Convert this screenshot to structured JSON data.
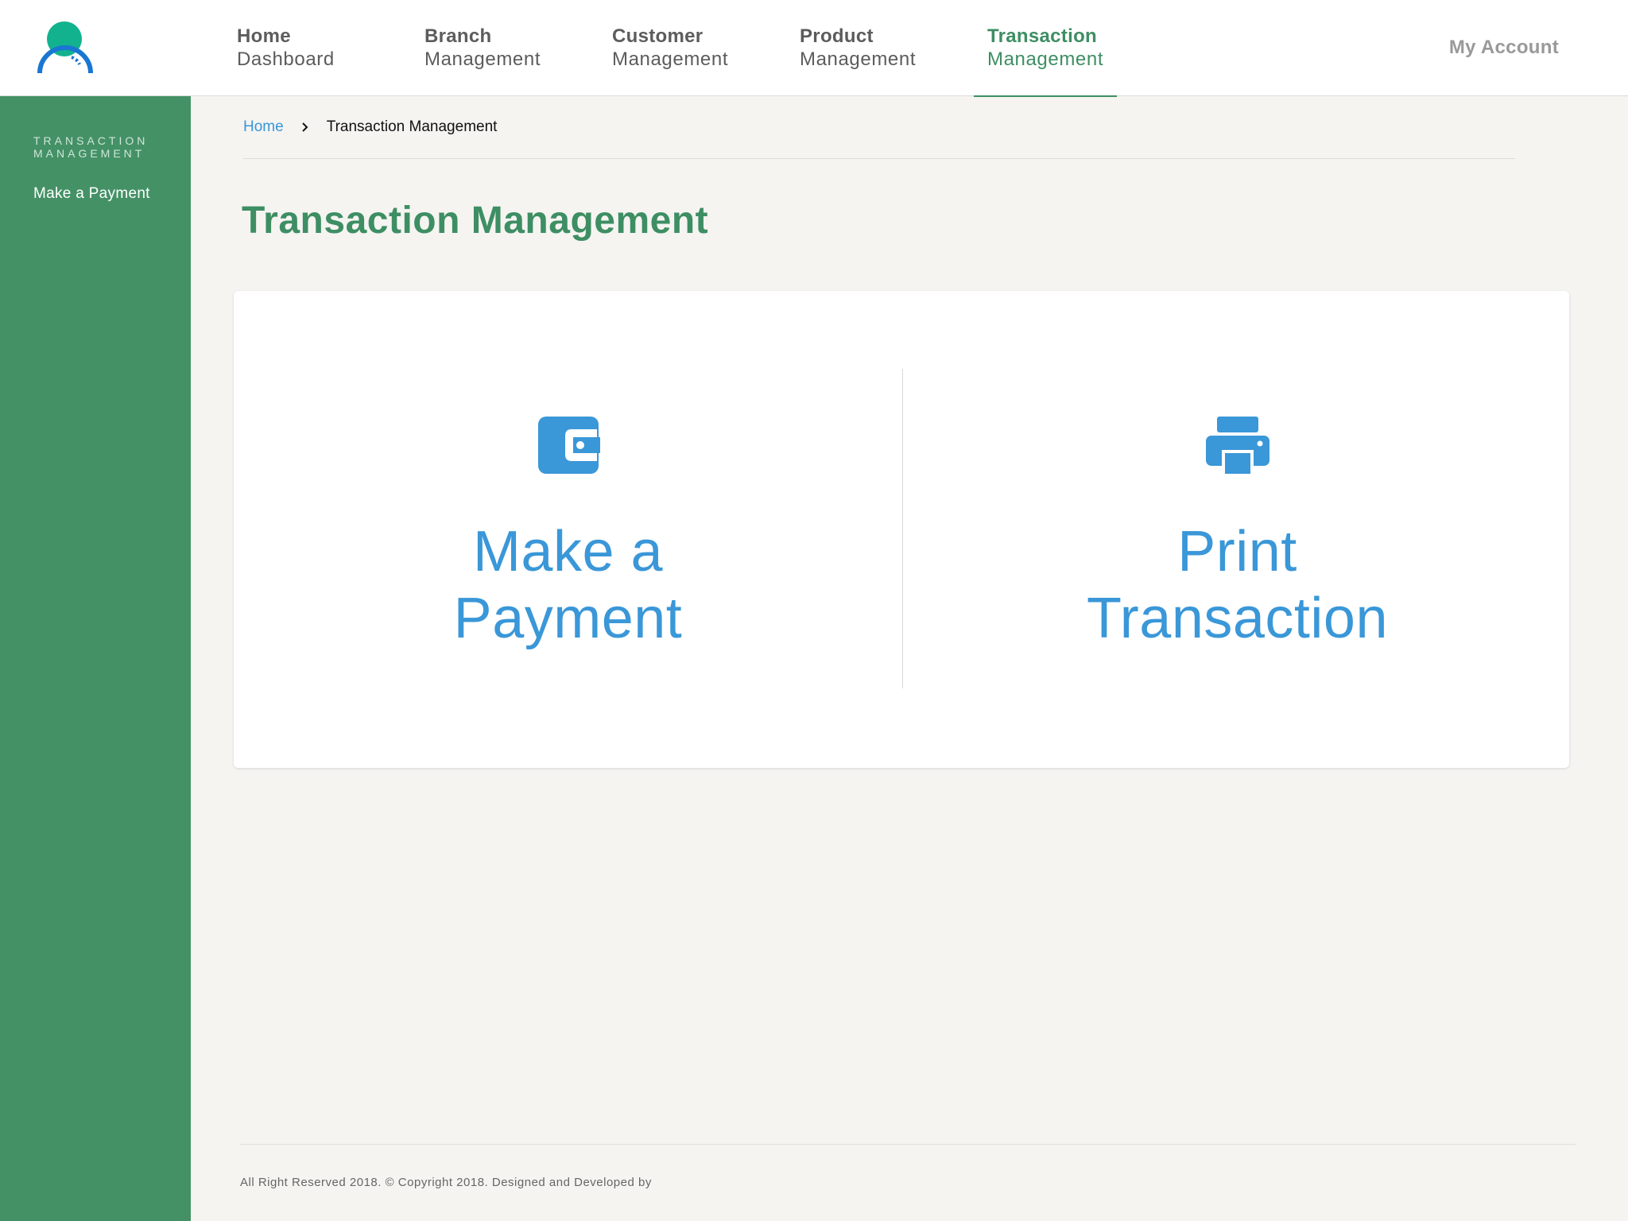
{
  "app": {
    "colors": {
      "accent_green": "#3e8e63",
      "sidebar_green": "#449166",
      "link_blue": "#3a97d8"
    }
  },
  "nav": {
    "items": [
      {
        "line1": "Home",
        "line2": "Dashboard",
        "active": false
      },
      {
        "line1": "Branch",
        "line2": "Management",
        "active": false
      },
      {
        "line1": "Customer",
        "line2": "Management",
        "active": false
      },
      {
        "line1": "Product",
        "line2": "Management",
        "active": false
      },
      {
        "line1": "Transaction",
        "line2": "Management",
        "active": true
      }
    ],
    "my_account": "My Account"
  },
  "sidebar": {
    "heading": "TRANSACTION MANAGEMENT",
    "items": [
      {
        "label": "Make a Payment"
      }
    ]
  },
  "breadcrumb": {
    "home": "Home",
    "current": "Transaction Management"
  },
  "page": {
    "title": "Transaction Management"
  },
  "tiles": [
    {
      "icon": "wallet-icon",
      "label": "Make a Payment"
    },
    {
      "icon": "printer-icon",
      "label": "Print Transaction"
    }
  ],
  "footer": {
    "text": "All Right Reserved 2018. © Copyright 2018. Designed and Developed by"
  }
}
